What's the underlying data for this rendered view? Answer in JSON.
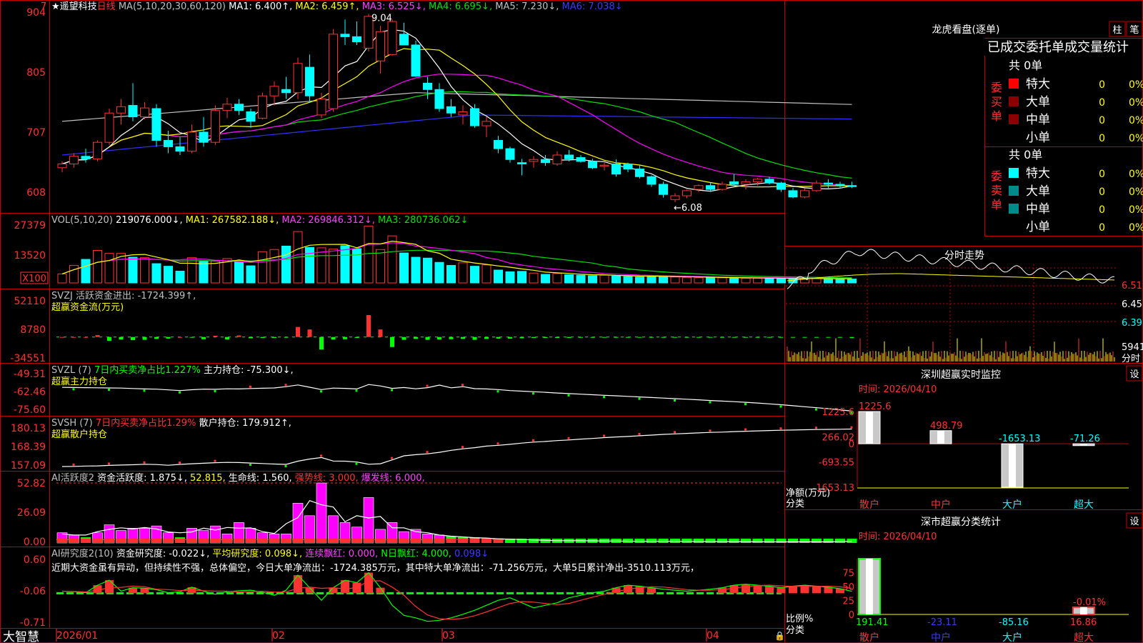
{
  "stock": {
    "name": "遥望科技",
    "period": "日线",
    "star": "★",
    "corner_mark": "7"
  },
  "colors": {
    "up": "#ff3232",
    "down": "#00ffff",
    "bg": "#000000",
    "frame": "#c00000",
    "ma1": "#ffffff",
    "ma2": "#ffff00",
    "ma3": "#ff00ff",
    "ma4": "#00e000",
    "ma5": "#c0c0c0",
    "ma6": "#3030ff",
    "green": "#00ff00"
  },
  "main": {
    "header": [
      {
        "t": "MA(5,10,20,30,60,120)",
        "c": "#c0c0c0"
      },
      {
        "t": "MA1: 6.400↑,",
        "c": "#ffffff"
      },
      {
        "t": "MA2: 6.459↑,",
        "c": "#ffff00"
      },
      {
        "t": "MA3: 6.525↓,",
        "c": "#ff40ff"
      },
      {
        "t": "MA4: 6.695↓,",
        "c": "#00e000"
      },
      {
        "t": "MA5: 7.230↓,",
        "c": "#c0c0c0"
      },
      {
        "t": "MA6: 7.038↓",
        "c": "#3a3aff"
      }
    ],
    "yticks": [
      "904",
      "805",
      "707",
      "608"
    ],
    "high_label": "9.04",
    "low_label": "←6.08"
  },
  "vol": {
    "header": [
      {
        "t": "VOL(5,10,20)",
        "c": "#c0c0c0"
      },
      {
        "t": "219076.000↓,",
        "c": "#ffffff"
      },
      {
        "t": "MA1: 267582.188↓,",
        "c": "#ffff00"
      },
      {
        "t": "MA2: 269846.312↓,",
        "c": "#ff40ff"
      },
      {
        "t": "MA3: 280736.062↓",
        "c": "#00e000"
      }
    ],
    "yticks": [
      "27379",
      "13520"
    ],
    "unit": "X100"
  },
  "svzj": {
    "header": [
      {
        "t": "SVZJ",
        "c": "#c0c0c0"
      },
      {
        "t": "活跃资金进出: -1724.399↑,",
        "c": "#c0c0c0"
      }
    ],
    "sub": "超赢资金流(万元)",
    "yticks": [
      "52110",
      "8780",
      "-34551"
    ]
  },
  "svzl": {
    "header": [
      {
        "t": "SVZL (7)",
        "c": "#c0c0c0"
      },
      {
        "t": "7日内买卖净占比1.227%",
        "c": "#00ff00"
      },
      {
        "t": "主力持仓: -75.300↓,",
        "c": "#ffffff"
      }
    ],
    "sub": "超赢主力持仓",
    "yticks": [
      "-49.31",
      "-62.46",
      "-75.60"
    ]
  },
  "svsh": {
    "header": [
      {
        "t": "SVSH (7)",
        "c": "#c0c0c0"
      },
      {
        "t": "7日内买卖净占比1.29%",
        "c": "#ff3232"
      },
      {
        "t": "散户持仓: 179.912↑,",
        "c": "#ffffff"
      }
    ],
    "sub": "超赢散户持仓",
    "yticks": [
      "180.13",
      "168.39",
      "157.09"
    ]
  },
  "ai1": {
    "header": [
      {
        "t": "AI活跃度2",
        "c": "#c0c0c0"
      },
      {
        "t": "资金活跃度: 1.875↓,",
        "c": "#ffffff"
      },
      {
        "t": "52.815,",
        "c": "#ffff00"
      },
      {
        "t": "生命线: 1.560,",
        "c": "#ffffff"
      },
      {
        "t": "强势线: 3.000,",
        "c": "#ff3232"
      },
      {
        "t": "爆发线: 6.000,",
        "c": "#ff40ff"
      }
    ],
    "yticks": [
      "52.82",
      "26.09",
      "0.00"
    ]
  },
  "ai2": {
    "header": [
      {
        "t": "AI研究度2(10)",
        "c": "#c0c0c0"
      },
      {
        "t": "资金研究度: -0.022↓,",
        "c": "#ffffff"
      },
      {
        "t": "平均研究度: 0.098↓,",
        "c": "#ffff00"
      },
      {
        "t": "连续飘红: 0.000,",
        "c": "#ff40ff"
      },
      {
        "t": "N日飘红: 4.000,",
        "c": "#00ff00"
      },
      {
        "t": "0.098↓",
        "c": "#3a3aff"
      }
    ],
    "comment": "近期大资金虽有异动，但持续性不强，总体偏空，今日大单净流出：-1724.385万元，其中特大单净流出：-71.256万元，大单5日累计净出-3510.113万元，",
    "yticks": [
      "0.60",
      "-0.06",
      "-0.71"
    ]
  },
  "xaxis": {
    "labels": [
      "2026/01",
      "02",
      "03",
      "04"
    ]
  },
  "brand": "大智慧",
  "longhu": {
    "title": "龙虎看盘(逐单)",
    "btn1": "柱",
    "btn2": "笔",
    "subtitle": "已成交委托单成交量统计",
    "buy_label": "委买单",
    "sell_label": "委卖单",
    "buy_total": "共 0单",
    "sell_total": "共 0单",
    "rows": [
      {
        "name": "特大",
        "v": "0",
        "p": "0%"
      },
      {
        "name": "大单",
        "v": "0",
        "p": "0%"
      },
      {
        "name": "中单",
        "v": "0",
        "p": "0%"
      },
      {
        "name": "小单",
        "v": "0",
        "p": "0%"
      }
    ]
  },
  "fenshi": {
    "title": "分时走势",
    "yticks": [
      "6.51",
      "6.45",
      "6.39"
    ],
    "vol_label": "5941",
    "vol_unit": "分时"
  },
  "monitor": {
    "title": "深圳超赢实时监控",
    "btn": "设",
    "time": "时间: 2026/04/10",
    "yticks": [
      "1225.6",
      "266.02",
      "0",
      "-693.55",
      "-1653.13"
    ],
    "ylabel1": "净额(万元)",
    "ylabel2": "分类"
  },
  "monitor_data": {
    "type": "bar",
    "categories": [
      "散户",
      "中户",
      "大户",
      "超大"
    ],
    "values": [
      1225.6,
      498.79,
      -1653.13,
      -71.26
    ],
    "value_labels": [
      "1225.6",
      "498.79",
      "-1653.13",
      "-71.26"
    ],
    "ylim": [
      -1653.13,
      1225.6
    ]
  },
  "classify": {
    "title": "深市超赢分类统计",
    "btn": "设",
    "time": "时间: 2026/04/10",
    "yticks": [
      "75",
      "50",
      "25",
      "0"
    ],
    "ylabel1": "比例%",
    "ylabel2": "分类",
    "top_label": "-0.01%"
  },
  "classify_data": {
    "type": "bar",
    "categories": [
      "散户",
      "中户",
      "大户",
      "超大"
    ],
    "values": [
      191.41,
      -23.11,
      -85.16,
      16.86
    ],
    "value_labels": [
      "191.41",
      "-23.11",
      "-85.16",
      "16.86"
    ]
  },
  "chart_data": {
    "type": "candlestick",
    "dates_from": "2026/01",
    "x_month_labels": [
      "2026/01",
      "02",
      "03",
      "04"
    ],
    "ylim": [
      6.0,
      9.1
    ],
    "high": 9.04,
    "low": 6.08,
    "ohlc": [
      [
        6.62,
        6.72,
        6.55,
        6.68
      ],
      [
        6.68,
        6.85,
        6.62,
        6.8
      ],
      [
        6.8,
        6.92,
        6.7,
        6.76
      ],
      [
        6.76,
        7.05,
        6.72,
        7.02
      ],
      [
        7.02,
        7.55,
        6.98,
        7.48
      ],
      [
        7.48,
        7.7,
        7.3,
        7.58
      ],
      [
        7.6,
        7.95,
        7.35,
        7.42
      ],
      [
        7.42,
        7.65,
        7.38,
        7.56
      ],
      [
        7.55,
        7.62,
        6.95,
        7.05
      ],
      [
        7.05,
        7.2,
        6.85,
        6.95
      ],
      [
        6.95,
        7.1,
        6.82,
        6.88
      ],
      [
        6.88,
        7.3,
        6.85,
        7.18
      ],
      [
        7.18,
        7.42,
        6.95,
        7.02
      ],
      [
        7.02,
        7.6,
        6.98,
        7.52
      ],
      [
        7.52,
        7.72,
        7.4,
        7.62
      ],
      [
        7.62,
        7.7,
        7.45,
        7.52
      ],
      [
        7.5,
        7.55,
        7.25,
        7.35
      ],
      [
        7.4,
        7.8,
        7.38,
        7.75
      ],
      [
        7.75,
        7.98,
        7.6,
        7.9
      ],
      [
        7.85,
        8.05,
        7.7,
        7.8
      ],
      [
        7.8,
        8.35,
        7.7,
        8.26
      ],
      [
        8.2,
        8.4,
        7.65,
        7.75
      ],
      [
        7.45,
        7.8,
        7.4,
        7.7
      ],
      [
        7.55,
        8.8,
        7.5,
        8.72
      ],
      [
        8.72,
        8.95,
        8.55,
        8.68
      ],
      [
        8.68,
        8.92,
        8.55,
        8.6
      ],
      [
        8.5,
        9.04,
        8.45,
        9.0
      ],
      [
        8.3,
        8.85,
        8.1,
        8.76
      ],
      [
        8.4,
        8.95,
        8.38,
        8.92
      ],
      [
        8.72,
        8.9,
        8.55,
        8.55
      ],
      [
        8.55,
        8.62,
        8.05,
        8.06
      ],
      [
        7.95,
        8.05,
        7.7,
        7.85
      ],
      [
        7.85,
        7.95,
        7.5,
        7.55
      ],
      [
        7.58,
        7.7,
        7.42,
        7.48
      ],
      [
        7.45,
        7.6,
        7.3,
        7.5
      ],
      [
        7.55,
        7.62,
        7.25,
        7.28
      ],
      [
        7.28,
        7.42,
        7.1,
        7.35
      ],
      [
        7.05,
        7.12,
        6.85,
        6.92
      ],
      [
        6.92,
        6.95,
        6.7,
        6.75
      ],
      [
        6.7,
        6.76,
        6.5,
        6.68
      ],
      [
        6.72,
        6.8,
        6.62,
        6.75
      ],
      [
        6.75,
        6.82,
        6.65,
        6.7
      ],
      [
        6.68,
        6.88,
        6.65,
        6.82
      ],
      [
        6.82,
        6.9,
        6.72,
        6.76
      ],
      [
        6.78,
        6.82,
        6.7,
        6.72
      ],
      [
        6.72,
        6.76,
        6.6,
        6.62
      ],
      [
        6.65,
        6.7,
        6.58,
        6.66
      ],
      [
        6.68,
        6.75,
        6.48,
        6.52
      ],
      [
        6.68,
        6.7,
        6.55,
        6.6
      ],
      [
        6.6,
        6.66,
        6.45,
        6.48
      ],
      [
        6.48,
        6.5,
        6.32,
        6.36
      ],
      [
        6.36,
        6.4,
        6.15,
        6.2
      ],
      [
        6.12,
        6.22,
        6.08,
        6.18
      ],
      [
        6.18,
        6.28,
        6.14,
        6.26
      ],
      [
        6.28,
        6.36,
        6.24,
        6.34
      ],
      [
        6.34,
        6.38,
        6.24,
        6.28
      ],
      [
        6.28,
        6.4,
        6.26,
        6.36
      ],
      [
        6.4,
        6.52,
        6.34,
        6.36
      ],
      [
        6.36,
        6.44,
        6.28,
        6.4
      ],
      [
        6.4,
        6.46,
        6.34,
        6.44
      ],
      [
        6.44,
        6.48,
        6.36,
        6.38
      ],
      [
        6.38,
        6.4,
        6.24,
        6.28
      ],
      [
        6.26,
        6.3,
        6.14,
        6.16
      ],
      [
        6.16,
        6.3,
        6.14,
        6.26
      ],
      [
        6.26,
        6.42,
        6.24,
        6.38
      ],
      [
        6.38,
        6.44,
        6.3,
        6.36
      ],
      [
        6.36,
        6.4,
        6.3,
        6.34
      ],
      [
        6.34,
        6.4,
        6.3,
        6.33
      ]
    ],
    "volume": [
      4200,
      8200,
      11000,
      15200,
      13800,
      13800,
      12000,
      11800,
      9000,
      7800,
      5500,
      11800,
      10400,
      10200,
      11400,
      9800,
      8000,
      14600,
      15600,
      17200,
      24000,
      16600,
      16400,
      15800,
      17400,
      16000,
      26600,
      15600,
      22000,
      14000,
      12000,
      11600,
      9600,
      8200,
      9400,
      7800,
      8400,
      6000,
      5200,
      5400,
      4600,
      4000,
      4400,
      3800,
      3600,
      3400,
      3600,
      3200,
      3000,
      2800,
      3200,
      3000,
      2800,
      2600,
      2400,
      2600,
      2400,
      2300,
      2200,
      2200,
      2100,
      2000,
      2100,
      2000,
      2100,
      1900,
      1900,
      1800
    ],
    "svzj": [
      0,
      0,
      0,
      3000,
      -6000,
      -4000,
      -5000,
      -4500,
      -3000,
      -2500,
      0,
      -1000,
      -3500,
      2000,
      -4000,
      2500,
      -2000,
      -1500,
      -1500,
      -1000,
      16000,
      12000,
      -20000,
      -4000,
      -3500,
      -1500,
      35000,
      12000,
      -16000,
      -4500,
      -3000,
      -4500,
      -4000,
      -3500,
      -3000,
      -4500,
      -3000,
      -2500,
      -2500,
      -2000,
      -1500,
      -1500,
      -1500,
      -1500,
      -1200,
      -1200,
      -1000,
      -1000,
      -1000,
      -900,
      -900,
      -800,
      -800,
      -800,
      -700,
      -700,
      -700,
      -600,
      -600,
      -600,
      -600,
      -500,
      -500,
      -500,
      -500,
      -400,
      -400,
      -1724
    ],
    "svzl_line": [
      -58.5,
      -58.6,
      -58.7,
      -58.8,
      -58.9,
      -59.0,
      -59.3,
      -59.6,
      -59.8,
      -60.3,
      -60.8,
      -60.2,
      -59.8,
      -59.9,
      -59.5,
      -59.6,
      -59.3,
      -59.1,
      -58.9,
      -58.0,
      -56.8,
      -58.4,
      -60.1,
      -59.0,
      -59.2,
      -59.6,
      -56.5,
      -57.5,
      -59.2,
      -58.6,
      -59.5,
      -58.7,
      -56.9,
      -58.8,
      -58.0,
      -59.4,
      -59.6,
      -60.1,
      -60.8,
      -61.2,
      -61.6,
      -62.0,
      -62.5,
      -62.9,
      -63.3,
      -63.7,
      -64.1,
      -64.5,
      -64.9,
      -65.3,
      -65.7,
      -66.1,
      -66.5,
      -66.9,
      -67.3,
      -67.8,
      -68.2,
      -68.6,
      -69.1,
      -69.6,
      -70.2,
      -70.8,
      -71.5,
      -72.2,
      -72.9,
      -73.6,
      -74.4,
      -75.3
    ],
    "svsh_line": [
      157.5,
      157.6,
      157.8,
      157.9,
      158.2,
      158.4,
      158.6,
      158.9,
      158.7,
      158.3,
      158.8,
      159.2,
      159.5,
      159.8,
      160.0,
      159.9,
      159.6,
      159.3,
      159.0,
      158.8,
      160.7,
      162.0,
      162.9,
      160.8,
      160.7,
      160.2,
      158.9,
      159.2,
      161.5,
      163.9,
      164.6,
      165.1,
      166.0,
      167.2,
      168.1,
      168.8,
      169.7,
      170.2,
      170.8,
      171.5,
      172.1,
      172.5,
      173.0,
      173.4,
      173.9,
      174.3,
      174.8,
      175.2,
      175.5,
      175.9,
      176.3,
      176.7,
      177.0,
      177.3,
      177.6,
      177.9,
      178.1,
      178.4,
      178.6,
      178.8,
      179.0,
      179.2,
      179.3,
      179.5,
      179.6,
      179.7,
      179.8,
      179.9
    ],
    "ai1": [
      9,
      7,
      5,
      9,
      16,
      11,
      13,
      13,
      15,
      9,
      5,
      13,
      11,
      15,
      8,
      18,
      13,
      9,
      8,
      8,
      35,
      24,
      52.8,
      24,
      18,
      14,
      40,
      12,
      18,
      10,
      12,
      8,
      7,
      6,
      5,
      5,
      4,
      4,
      3,
      3,
      3,
      2,
      2,
      2,
      2,
      1.8,
      1.8,
      1.6,
      1.6,
      1.5,
      1.5,
      1.5,
      1.4,
      1.4,
      1.3,
      1.3,
      1.3,
      1.2,
      1.2,
      1.2,
      1.1,
      1.1,
      1.0,
      1.0,
      1.0,
      1.0,
      1.0,
      1.875
    ],
    "ai2": [
      -0.02,
      -0.03,
      -0.05,
      0.1,
      0.2,
      -0.02,
      0.05,
      0.04,
      0.01,
      -0.05,
      -0.03,
      0.06,
      -0.02,
      -0.08,
      -0.03,
      -0.01,
      0.0,
      -0.04,
      -0.1,
      0.0,
      0.3,
      0.05,
      -0.2,
      0.05,
      0.2,
      0.15,
      0.35,
      0.05,
      -0.3,
      -0.5,
      -0.55,
      -0.62,
      -0.6,
      -0.55,
      -0.48,
      -0.4,
      -0.3,
      -0.2,
      -0.15,
      -0.25,
      -0.35,
      -0.3,
      -0.25,
      -0.15,
      -0.1,
      -0.05,
      -0.02,
      0.05,
      0.1,
      0.08,
      0.05,
      0.02,
      0.0,
      -0.02,
      0.0,
      0.02,
      0.05,
      0.1,
      0.12,
      0.1,
      0.08,
      0.05,
      0.08,
      0.1,
      0.08,
      0.06,
      0.03,
      -0.022
    ]
  }
}
